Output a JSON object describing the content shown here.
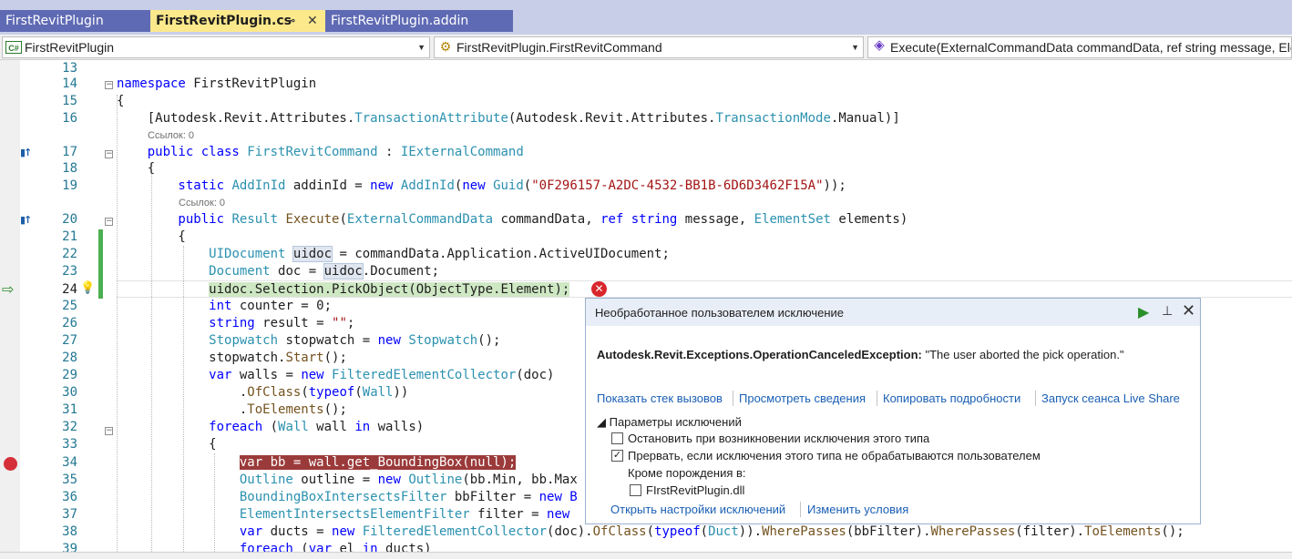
{
  "tabs": [
    {
      "label": "FirstRevitPlugin"
    },
    {
      "label": "FirstRevitPlugin.cs",
      "active": true
    },
    {
      "label": "FirstRevitPlugin.addin"
    }
  ],
  "tab_pin_glyph": "⊸",
  "tab_close_glyph": "✕",
  "navbar": {
    "project": "FirstRevitPlugin",
    "class": "FirstRevitPlugin.FirstRevitCommand",
    "member": "Execute(ExternalCommandData commandData, ref string message, ElementSet elements)",
    "csharp_badge": "C#",
    "dropdown_glyph": "▼"
  },
  "editor": {
    "line_numbers": [
      "13",
      "14",
      "15",
      "16",
      "17",
      "18",
      "19",
      "20",
      "21",
      "22",
      "23",
      "24",
      "25",
      "26",
      "27",
      "28",
      "29",
      "30",
      "31",
      "32",
      "33",
      "34",
      "35",
      "36",
      "37",
      "38",
      "39"
    ],
    "code_lens_1": "Ссылок: 0",
    "code_lens_2": "Ссылок: 0",
    "code": {
      "l14_a": "namespace",
      "l14_b": " FirstRevitPlugin",
      "l15": "{",
      "l16_a": "    [Autodesk.Revit.Attributes.",
      "l16_b": "TransactionAttribute",
      "l16_c": "(Autodesk.Revit.Attributes.",
      "l16_d": "TransactionMode",
      "l16_e": ".Manual)]",
      "l17_a": "    public class ",
      "l17_b": "FirstRevitCommand",
      "l17_c": " : ",
      "l17_d": "IExternalCommand",
      "l18": "    {",
      "l19_a": "        static ",
      "l19_b": "AddInId",
      "l19_c": " addinId = ",
      "l19_d": "new ",
      "l19_e": "AddInId",
      "l19_f": "(",
      "l19_g": "new ",
      "l19_h": "Guid",
      "l19_i": "(",
      "l19_j": "\"0F296157-A2DC-4532-BB1B-6D6D3462F15A\"",
      "l19_k": "));",
      "l20_a": "        public ",
      "l20_b": "Result",
      "l20_c": " ",
      "l20_d": "Execute",
      "l20_e": "(",
      "l20_f": "ExternalCommandData",
      "l20_g": " commandData, ",
      "l20_h": "ref string",
      "l20_i": " message, ",
      "l20_j": "ElementSet",
      "l20_k": " elements)",
      "l21": "        {",
      "l22_a": "            ",
      "l22_b": "UIDocument",
      "l22_c": " ",
      "l22_d": "uidoc",
      "l22_e": " = commandData.Application.ActiveUIDocument;",
      "l23_a": "            ",
      "l23_b": "Document",
      "l23_c": " doc = ",
      "l23_d": "uidoc",
      "l23_e": ".Document;",
      "l24_a": "            ",
      "l24_b": "uidoc.Selection.PickObject(ObjectType.Element);",
      "l25_a": "            ",
      "l25_b": "int",
      "l25_c": " counter = 0;",
      "l26_a": "            ",
      "l26_b": "string",
      "l26_c": " result = ",
      "l26_d": "\"\"",
      "l26_e": ";",
      "l27_a": "            ",
      "l27_b": "Stopwatch",
      "l27_c": " stopwatch = ",
      "l27_d": "new ",
      "l27_e": "Stopwatch",
      "l27_f": "();",
      "l28_a": "            stopwatch.",
      "l28_b": "Start",
      "l28_c": "();",
      "l29_a": "            ",
      "l29_b": "var",
      "l29_c": " walls = ",
      "l29_d": "new ",
      "l29_e": "FilteredElementCollector",
      "l29_f": "(doc)",
      "l30_a": "                .",
      "l30_b": "OfClass",
      "l30_c": "(",
      "l30_d": "typeof",
      "l30_e": "(",
      "l30_f": "Wall",
      "l30_g": "))",
      "l31_a": "                .",
      "l31_b": "ToElements",
      "l31_c": "();",
      "l32_a": "            ",
      "l32_b": "foreach",
      "l32_c": " (",
      "l32_d": "Wall",
      "l32_e": " wall ",
      "l32_f": "in",
      "l32_g": " walls)",
      "l33": "            {",
      "l34_a": "                ",
      "l34_b": "var bb = wall.get_BoundingBox(null);",
      "l35_a": "                ",
      "l35_b": "Outline",
      "l35_c": " outline = ",
      "l35_d": "new ",
      "l35_e": "Outline",
      "l35_f": "(bb.Min, bb.Max",
      "l36_a": "                ",
      "l36_b": "BoundingBoxIntersectsFilter",
      "l36_c": " bbFilter = ",
      "l36_d": "new B",
      "l37_a": "                ",
      "l37_b": "ElementIntersectsElementFilter",
      "l37_c": " filter = ",
      "l37_d": "new",
      "l38_a": "                ",
      "l38_b": "var",
      "l38_c": " ducts = ",
      "l38_d": "new ",
      "l38_e": "FilteredElementCollector",
      "l38_f": "(doc).",
      "l38_g": "OfClass",
      "l38_h": "(",
      "l38_i": "typeof",
      "l38_j": "(",
      "l38_k": "Duct",
      "l38_l": ")).",
      "l38_m": "WherePasses",
      "l38_n": "(bbFilter).",
      "l38_o": "WherePasses",
      "l38_p": "(filter).",
      "l38_q": "ToElements",
      "l38_r": "();",
      "l39_a": "                ",
      "l39_b": "foreach",
      "l39_c": " (",
      "l39_d": "var",
      "l39_e": " el ",
      "l39_f": "in",
      "l39_g": " ducts)"
    },
    "fold_minus": "−",
    "exec_arrow_glyph": "⇨",
    "ref_icon_glyph": "▮↑",
    "bulb_glyph": "💡",
    "error_glyph": "✕"
  },
  "exception": {
    "title": "Необработанное пользователем исключение",
    "exception_type": "Autodesk.Revit.Exceptions.OperationCanceledException:",
    "exception_message": " \"The user aborted the pick operation.\"",
    "links": [
      "Показать стек вызовов",
      "Просмотреть сведения",
      "Копировать подробности",
      "Запуск сеанса Live Share"
    ],
    "options_header": "◢ Параметры исключений",
    "opt_break_when_thrown": "Остановить при возникновении исключения этого типа",
    "opt_break_when_unhandled": "Прервать, если исключения этого типа не обрабатываются пользователем",
    "except_when_from": "Кроме порождения в:",
    "module": "FIrstRevitPlugin.dll",
    "open_settings": "Открыть настройки исключений",
    "edit_conditions": "Изменить условия",
    "continue_glyph": "▶",
    "pin_glyph": "⊥",
    "close_glyph": "✕",
    "checked_glyph": "✓",
    "checks": {
      "break_when_thrown": false,
      "break_when_unhandled": true,
      "except_module": false
    }
  },
  "colors": {
    "keyword": "#0000ff",
    "type": "#2b91af",
    "string": "#a31515",
    "method": "#74531f",
    "line_number": "#237893",
    "breakpoint": "#d5303a",
    "active_tab": "#fce98c",
    "inactive_tab": "#5f6ab4"
  }
}
